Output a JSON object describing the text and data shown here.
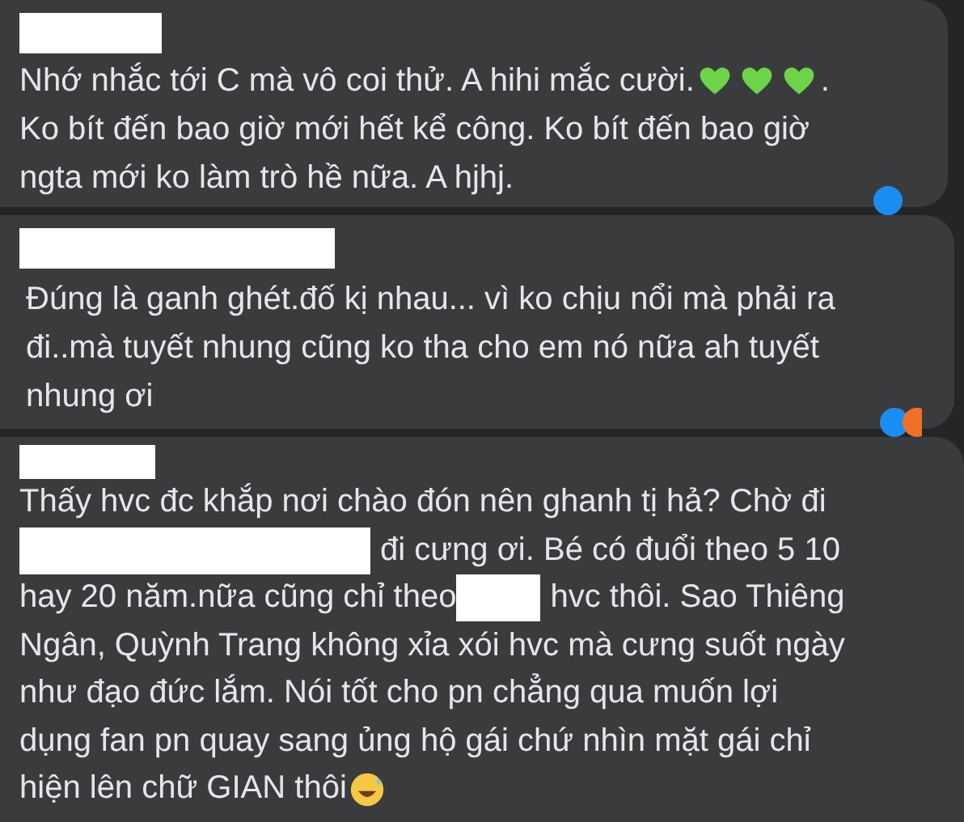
{
  "comments": [
    {
      "lines": [
        [
          {
            "kind": "text",
            "text": "Nhớ nhắc tới C mà vô coi thử. A hihi mắc cười. "
          },
          {
            "kind": "heart"
          },
          {
            "kind": "heart"
          },
          {
            "kind": "heart"
          },
          {
            "kind": "text",
            "text": "."
          }
        ],
        [
          {
            "kind": "text",
            "text": "Ko bít đến bao giờ mới hết kể công. Ko bít đến bao giờ"
          }
        ],
        [
          {
            "kind": "text",
            "text": "ngta mới ko làm trò hề nữa. A hjhj."
          }
        ]
      ]
    },
    {
      "lines": [
        [
          {
            "kind": "text",
            "text": "Đúng là ganh ghét.đố kị nhau... vì ko chịu nổi mà phải ra"
          }
        ],
        [
          {
            "kind": "text",
            "text": "đi..mà tuyết nhung cũng ko tha cho em nó nữa ah tuyết"
          }
        ],
        [
          {
            "kind": "text",
            "text": "nhung ơi"
          }
        ]
      ]
    },
    {
      "lines": [
        [
          {
            "kind": "text",
            "text": "Thấy hvc đc khắp nơi chào đón nên ghanh tị hả? Chờ đi"
          }
        ],
        [
          {
            "kind": "redacted"
          },
          {
            "kind": "text",
            "text": "đi cưng ơi. Bé có đuổi theo 5 10"
          }
        ],
        [
          {
            "kind": "text",
            "text": "hay 20 năm.nữa cũng chỉ theo"
          },
          {
            "kind": "redacted"
          },
          {
            "kind": "text",
            "text": "hvc thôi. Sao Thiêng"
          }
        ],
        [
          {
            "kind": "text",
            "text": "Ngân, Quỳnh Trang không xỉa xói hvc mà cưng suốt ngày"
          }
        ],
        [
          {
            "kind": "text",
            "text": "như đạo đức lắm. Nói tốt cho pn chẳng qua muốn lợi"
          }
        ],
        [
          {
            "kind": "text",
            "text": "dụng fan pn quay sang ủng hộ gái chứ nhìn mặt gái chỉ"
          }
        ],
        [
          {
            "kind": "text",
            "text": "hiện lên chữ GIAN thôi"
          },
          {
            "kind": "laugh"
          }
        ]
      ]
    }
  ]
}
